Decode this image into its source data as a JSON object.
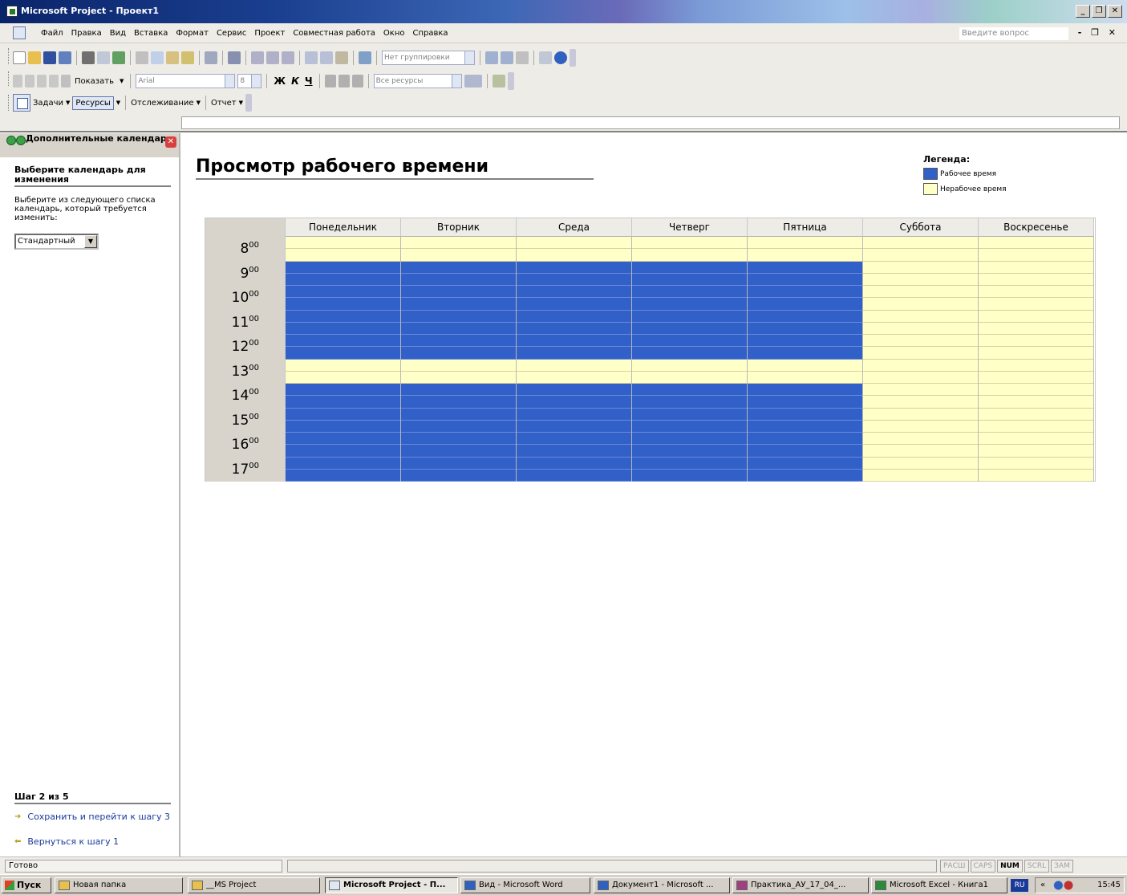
{
  "window": {
    "title": "Microsoft Project - Проект1"
  },
  "menu": {
    "items": [
      "Файл",
      "Правка",
      "Вид",
      "Вставка",
      "Формат",
      "Сервис",
      "Проект",
      "Совместная работа",
      "Окно",
      "Справка"
    ],
    "help_placeholder": "Введите вопрос"
  },
  "toolbar1": {
    "grouping_label": "Нет группировки"
  },
  "toolbar2": {
    "show_label": "Показать",
    "font": "Arial",
    "font_size": "8",
    "bold": "Ж",
    "italic": "К",
    "underline": "Ч",
    "resources_filter": "Все ресурсы"
  },
  "guide_bar": {
    "tasks": "Задачи",
    "resources": "Ресурсы",
    "tracking": "Отслеживание",
    "report": "Отчет"
  },
  "side_pane": {
    "title": "Дополнительные календари",
    "section_title": "Выберите календарь для изменения",
    "instruction": "Выберите из следующего списка календарь, который требуется изменить:",
    "calendar_selected": "Стандартный",
    "step": "Шаг 2 из 5",
    "link_save": "Сохранить и перейти к шагу 3",
    "link_back": "Вернуться к шагу 1"
  },
  "main": {
    "title": "Просмотр рабочего времени",
    "legend": {
      "title": "Легенда:",
      "working": "Рабочее время",
      "nonworking": "Нерабочее время"
    },
    "colors": {
      "working": "#3060c8",
      "nonworking": "#ffffc8"
    },
    "days": [
      "Понедельник",
      "Вторник",
      "Среда",
      "Четверг",
      "Пятница",
      "Суббота",
      "Воскресенье"
    ],
    "hours": [
      "8",
      "9",
      "10",
      "11",
      "12",
      "13",
      "14",
      "15",
      "16",
      "17"
    ],
    "hour_suffix": "00",
    "working_days": [
      true,
      true,
      true,
      true,
      true,
      false,
      false
    ],
    "working_hours": [
      false,
      true,
      true,
      true,
      true,
      false,
      true,
      true,
      true,
      true
    ]
  },
  "status": {
    "ready": "Готово",
    "indicators": [
      "РАСШ",
      "CAPS",
      "NUM",
      "SCRL",
      "ЗАМ"
    ],
    "active_indicator": "NUM"
  },
  "taskbar": {
    "start": "Пуск",
    "tasks": [
      "Новая папка",
      "__MS Project",
      "Microsoft Project - П...",
      "Вид - Microsoft Word",
      "Документ1 - Microsoft ...",
      "Практика_АУ_17_04_...",
      "Microsoft Excel - Книга1"
    ],
    "lang": "RU",
    "clock": "15:45"
  }
}
